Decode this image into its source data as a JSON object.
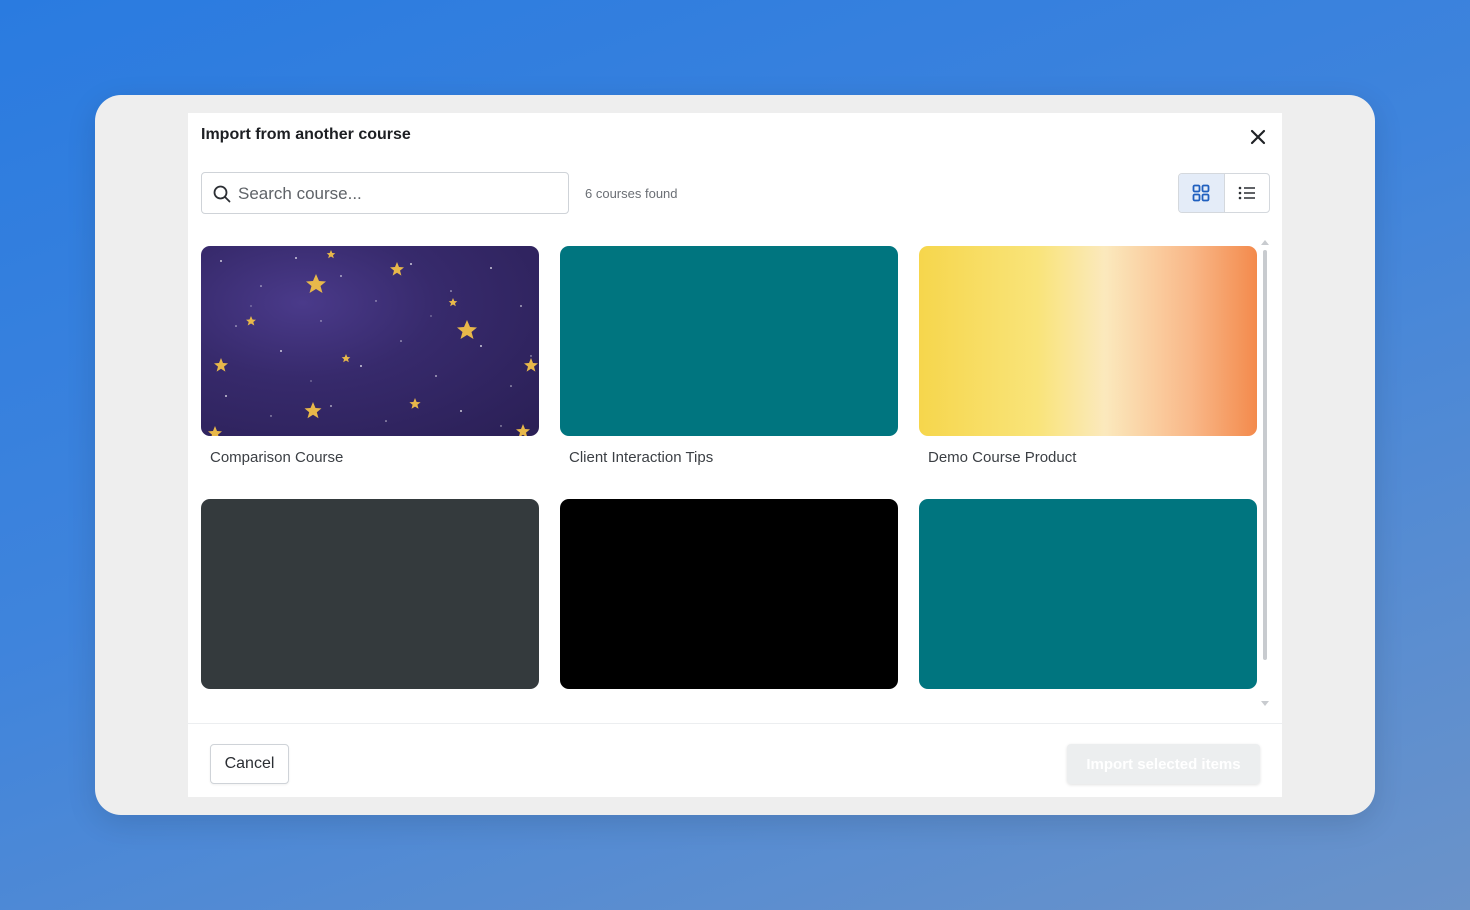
{
  "modal": {
    "title": "Import from another course"
  },
  "search": {
    "placeholder": "Search course..."
  },
  "results": {
    "count_text": "6 courses found"
  },
  "view_toggle": {
    "active": "grid"
  },
  "courses": [
    {
      "title": "Comparison Course",
      "thumbnail": "starry-night",
      "color": "#3b2d6e"
    },
    {
      "title": "Client Interaction Tips",
      "thumbnail": "solid",
      "color": "#00757f"
    },
    {
      "title": "Demo Course Product",
      "thumbnail": "yellow-orange-gradient",
      "color": "#f7d85a"
    },
    {
      "title": "",
      "thumbnail": "solid",
      "color": "#343a3d"
    },
    {
      "title": "",
      "thumbnail": "solid",
      "color": "#000000"
    },
    {
      "title": "",
      "thumbnail": "solid",
      "color": "#00757f"
    }
  ],
  "footer": {
    "cancel_label": "Cancel",
    "import_label": "Import selected items"
  }
}
